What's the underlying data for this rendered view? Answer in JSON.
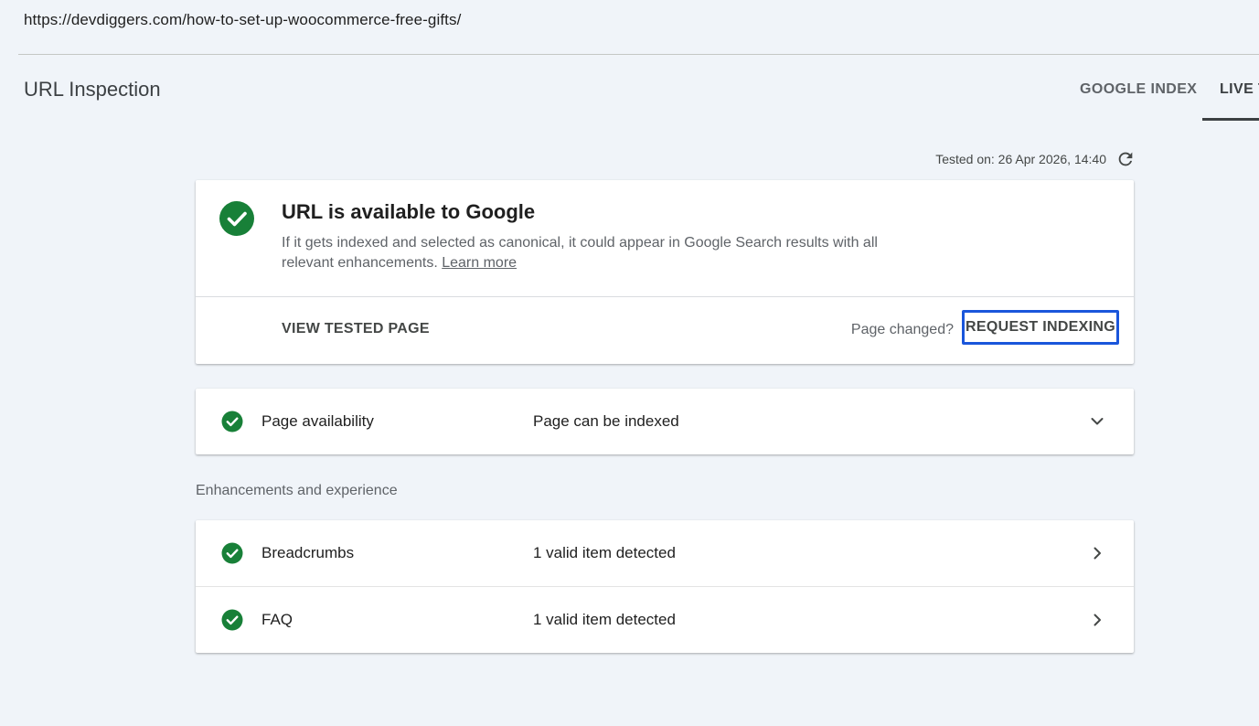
{
  "url": "https://devdiggers.com/how-to-set-up-woocommerce-free-gifts/",
  "page_title": "URL Inspection",
  "tabs": [
    {
      "label": "GOOGLE INDEX"
    },
    {
      "label": "LIVE T"
    }
  ],
  "tested_on": "Tested on: 26 Apr 2026, 14:40",
  "result": {
    "heading": "URL is available to Google",
    "description": "If it gets indexed and selected as canonical, it could appear in Google Search results with all relevant enhancements.",
    "learn_more": "Learn more",
    "view_tested_page": "VIEW TESTED PAGE",
    "page_changed": "Page changed?",
    "request_indexing": "REQUEST INDEXING"
  },
  "availability": {
    "label": "Page availability",
    "value": "Page can be indexed"
  },
  "enhancements": {
    "section_label": "Enhancements and experience",
    "items": [
      {
        "label": "Breadcrumbs",
        "value": "1 valid item detected"
      },
      {
        "label": "FAQ",
        "value": "1 valid item detected"
      }
    ]
  },
  "colors": {
    "background": "#f0f4f9",
    "success_green": "#188038",
    "highlight_border": "#1a56db"
  },
  "icons": {
    "status": "check-circle-icon",
    "refresh": "refresh-icon",
    "expand": "chevron-down-icon",
    "navigate": "chevron-right-icon"
  }
}
